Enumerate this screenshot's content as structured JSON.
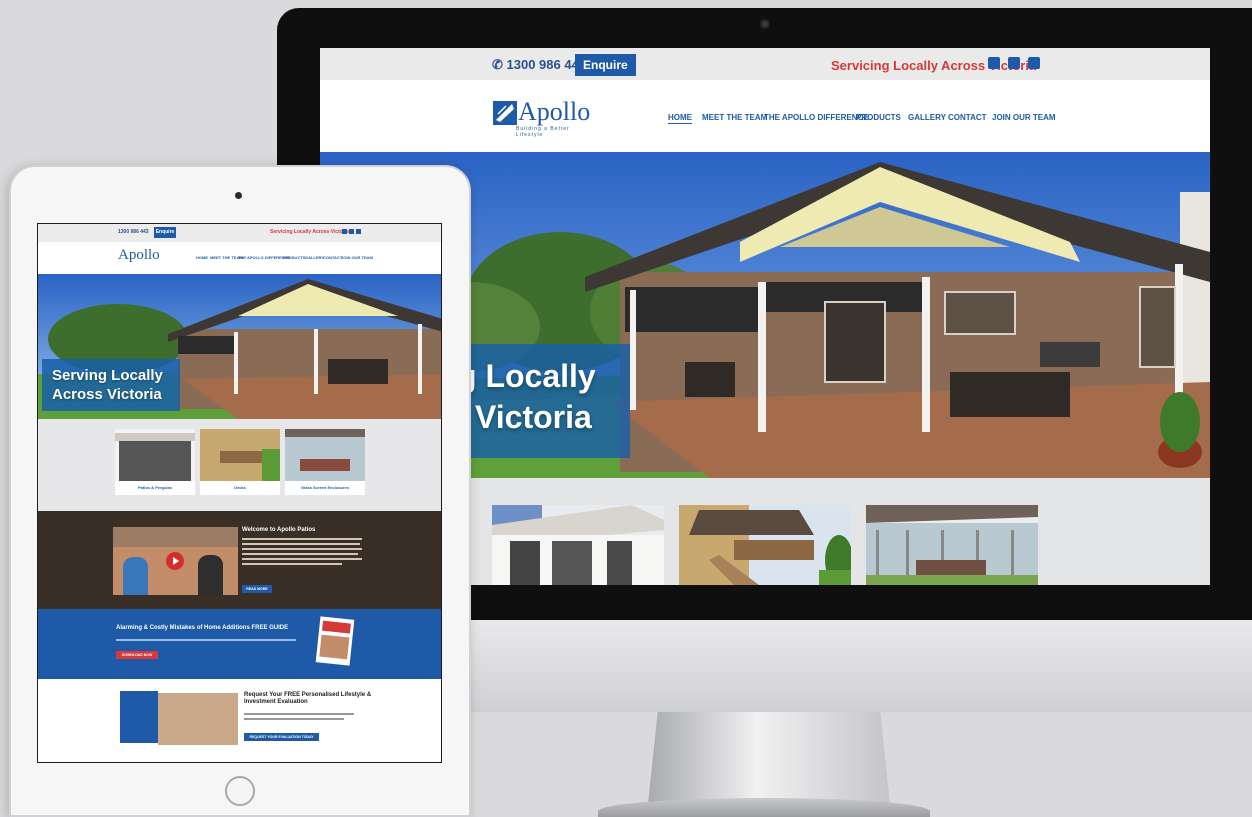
{
  "desktop": {
    "topbar": {
      "phone": "1300 986 443",
      "enquire_label": "Enquire",
      "tagline": "Servicing Locally Across Victoria",
      "social_icons": [
        "facebook-icon",
        "instagram-icon",
        "linkedin-icon"
      ]
    },
    "logo": {
      "name": "Apollo",
      "sub": "Patios",
      "tagline": "Building a Better Lifestyle"
    },
    "nav": [
      {
        "label": "HOME",
        "active": true
      },
      {
        "label": "MEET THE TEAM"
      },
      {
        "label": "THE APOLLO DIFFERENCE"
      },
      {
        "label": "PRODUCTS"
      },
      {
        "label": "GALLERY"
      },
      {
        "label": "CONTACT"
      },
      {
        "label": "JOIN OUR TEAM"
      }
    ],
    "hero": {
      "line1": "g Locally",
      "line2": "Victoria"
    }
  },
  "tablet": {
    "topbar": {
      "phone": "1300 986 443",
      "enquire_label": "Enquire",
      "tagline": "Servicing Locally Across Victoria"
    },
    "logo": "Apollo",
    "nav": [
      "HOME",
      "MEET THE TEAM",
      "THE APOLLO DIFFERENCE",
      "PRODUCTS",
      "GALLERY",
      "CONTACT",
      "JOIN OUR TEAM"
    ],
    "hero": {
      "line1": "Serving Locally",
      "line2": "Across Victoria"
    },
    "products": [
      {
        "label": "Patios & Pergolas"
      },
      {
        "label": "Decks"
      },
      {
        "label": "Glass Screen Enclosures"
      }
    ],
    "welcome": {
      "title": "Welcome to Apollo Patios",
      "button": "READ MORE"
    },
    "guide": {
      "title": "Alarming & Costly Mistakes of Home Additions FREE GUIDE",
      "button": "DOWNLOAD NOW"
    },
    "eval": {
      "title": "Request Your FREE Personalised Lifestyle & Investment Evaluation",
      "button": "REQUEST YOUR EVALUATION TODAY"
    }
  },
  "colors": {
    "brand_blue": "#1e5aa8",
    "accent_red": "#d43a3a",
    "bezel": "#0f0f10"
  }
}
